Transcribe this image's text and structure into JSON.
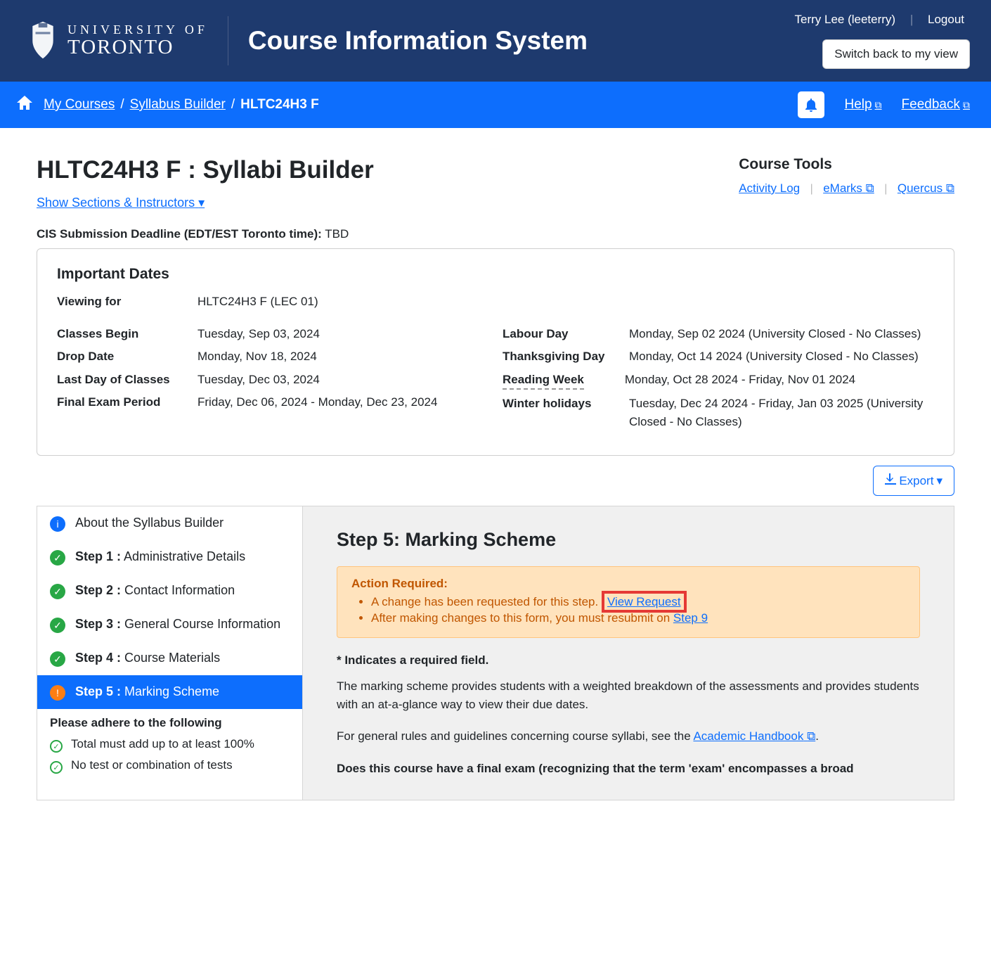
{
  "header": {
    "uni_top": "UNIVERSITY OF",
    "uni_bottom": "TORONTO",
    "app_title": "Course Information System",
    "user_display": "Terry Lee (leeterry)",
    "logout": "Logout",
    "switch_view": "Switch back to my view"
  },
  "navbar": {
    "my_courses": "My Courses",
    "syllabus_builder": "Syllabus Builder",
    "current": "HLTC24H3 F",
    "help": "Help",
    "feedback": "Feedback"
  },
  "page": {
    "title": "HLTC24H3 F : Syllabi Builder",
    "show_sections": "Show Sections & Instructors",
    "deadline_label": "CIS Submission Deadline (EDT/EST Toronto time):",
    "deadline_value": "TBD"
  },
  "tools": {
    "title": "Course Tools",
    "activity_log": "Activity Log",
    "emarks": "eMarks",
    "quercus": "Quercus"
  },
  "dates": {
    "title": "Important Dates",
    "viewing_label": "Viewing for",
    "viewing_value": "HLTC24H3 F (LEC 01)",
    "left": [
      {
        "label": "Classes Begin",
        "value": "Tuesday, Sep 03, 2024"
      },
      {
        "label": "Drop Date",
        "value": "Monday, Nov 18, 2024"
      },
      {
        "label": "Last Day of Classes",
        "value": "Tuesday, Dec 03, 2024"
      },
      {
        "label": "Final Exam Period",
        "value": "Friday, Dec 06, 2024 - Monday, Dec 23, 2024"
      }
    ],
    "right": [
      {
        "label": "Labour Day",
        "value": "Monday, Sep 02 2024 (University Closed - No Classes)"
      },
      {
        "label": "Thanksgiving Day",
        "value": "Monday, Oct 14 2024 (University Closed - No Classes)"
      },
      {
        "label": "Reading Week",
        "value": "Monday, Oct 28 2024 - Friday, Nov 01 2024",
        "dashed": true
      },
      {
        "label": "Winter holidays",
        "value": "Tuesday, Dec 24 2024 - Friday, Jan 03 2025 (University Closed - No Classes)"
      }
    ]
  },
  "export_label": "Export",
  "sidebar": {
    "about": "About the Syllabus Builder",
    "steps": [
      {
        "step": "Step 1 :",
        "name": " Administrative Details"
      },
      {
        "step": "Step 2 :",
        "name": " Contact Information"
      },
      {
        "step": "Step 3 :",
        "name": " General Course Information"
      },
      {
        "step": "Step 4 :",
        "name": " Course Materials"
      },
      {
        "step": "Step 5 :",
        "name": " Marking Scheme"
      }
    ],
    "note_title": "Please adhere to the following",
    "notes": [
      "Total must add up to at least 100%",
      "No test or combination of tests"
    ]
  },
  "content": {
    "step_title": "Step 5: Marking Scheme",
    "alert_title": "Action Required:",
    "alert_line1_a": "A change has been requested for this step.",
    "alert_link1": "View Request",
    "alert_line2_a": "After making changes to this form, you must resubmit on ",
    "alert_link2": "Step 9",
    "required_note": "* Indicates a required field.",
    "para1": "The marking scheme provides students with a weighted breakdown of the assessments and provides students with an at-a-glance way to view their due dates.",
    "para2_a": "For general rules and guidelines concerning course syllabi, see the ",
    "para2_link": "Academic Handbook",
    "para2_b": ".",
    "question": "Does this course have a final exam (recognizing that the term 'exam' encompasses a broad"
  }
}
